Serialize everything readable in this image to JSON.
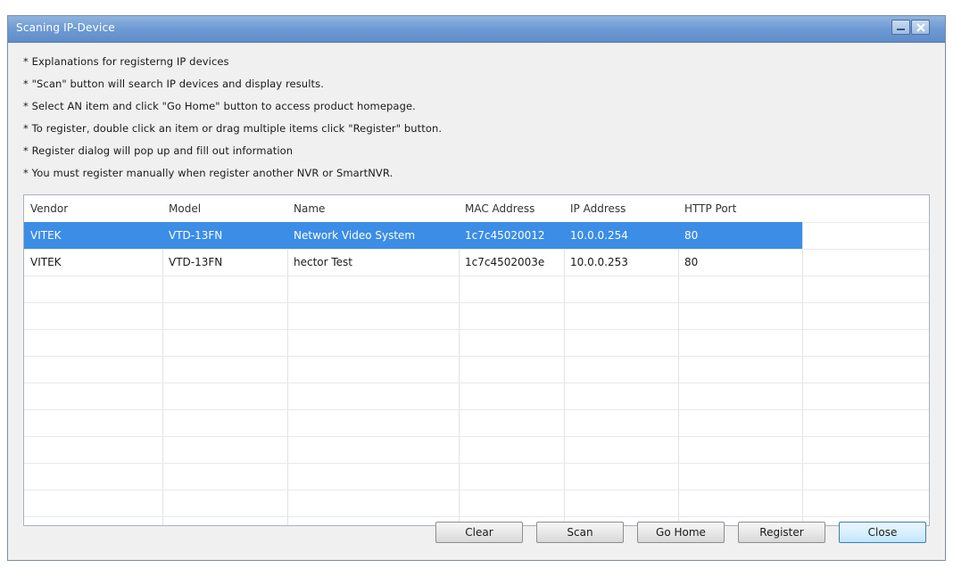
{
  "window": {
    "title": "Scaning IP-Device"
  },
  "explanations": [
    "* Explanations for registerng IP devices",
    "* \"Scan\" button will search IP devices and display results.",
    "* Select AN item and click \"Go Home\" button to access product homepage.",
    "* To register, double click an item or drag multiple items click \"Register\" button.",
    "* Register dialog will pop up and fill out information",
    "* You must register manually when register another NVR or SmartNVR."
  ],
  "table": {
    "columns": [
      "Vendor",
      "Model",
      "Name",
      "MAC Address",
      "IP Address",
      "HTTP Port"
    ],
    "rows": [
      [
        "VITEK",
        "VTD-13FN",
        "Network Video System",
        "1c7c45020012",
        "10.0.0.254",
        "80"
      ],
      [
        "VITEK",
        "VTD-13FN",
        "hector Test",
        "1c7c4502003e",
        "10.0.0.253",
        "80"
      ]
    ],
    "selected_row": 0,
    "selection_color": "#3c8de6"
  },
  "buttons": {
    "clear": "Clear",
    "scan": "Scan",
    "go_home": "Go Home",
    "register": "Register",
    "close": "Close"
  },
  "icons": {
    "minimize": "minimize-icon",
    "close": "close-icon"
  }
}
